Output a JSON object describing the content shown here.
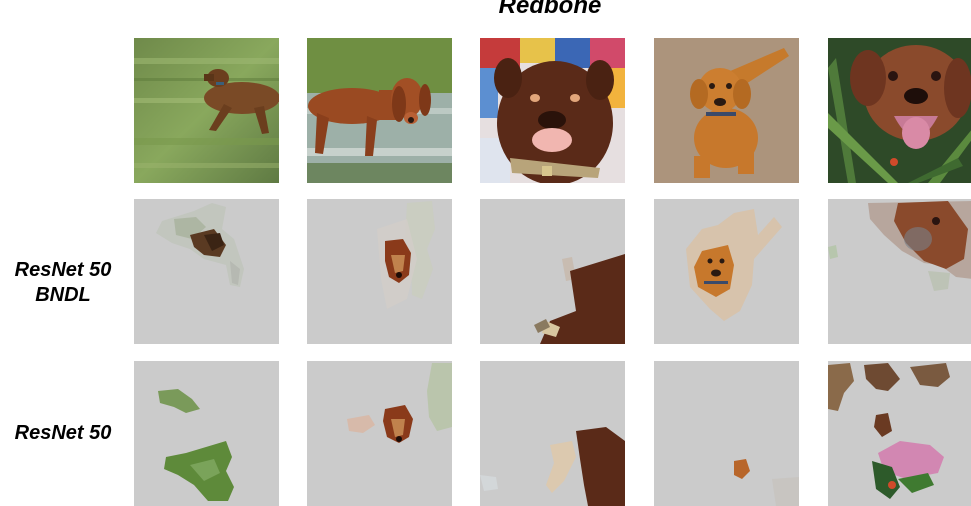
{
  "figure": {
    "title": "Redbone",
    "row_labels": {
      "original": "",
      "bndl": [
        "ResNet 50",
        "BNDL"
      ],
      "baseline": "ResNet 50"
    }
  },
  "rows": [
    {
      "id": "original",
      "tiles": [
        {
          "subject": "dog running on grass, motion blur"
        },
        {
          "subject": "redbone hound standing by pond"
        },
        {
          "subject": "close-up brown dog on quilt"
        },
        {
          "subject": "puppy sitting on carpet"
        },
        {
          "subject": "dog lying in grass, tongue out"
        }
      ]
    },
    {
      "id": "bndl",
      "tiles": [
        {
          "subject": "saliency mask: dog head and body region"
        },
        {
          "subject": "saliency mask: dog head"
        },
        {
          "subject": "saliency mask: dog body and collar"
        },
        {
          "subject": "saliency mask: full puppy"
        },
        {
          "subject": "saliency mask: dog face"
        }
      ]
    },
    {
      "id": "baseline",
      "tiles": [
        {
          "subject": "saliency mask: grass patches"
        },
        {
          "subject": "saliency mask: dog head and background"
        },
        {
          "subject": "saliency mask: partial body"
        },
        {
          "subject": "saliency mask: small patch"
        },
        {
          "subject": "saliency mask: scattered fragments"
        }
      ]
    }
  ]
}
